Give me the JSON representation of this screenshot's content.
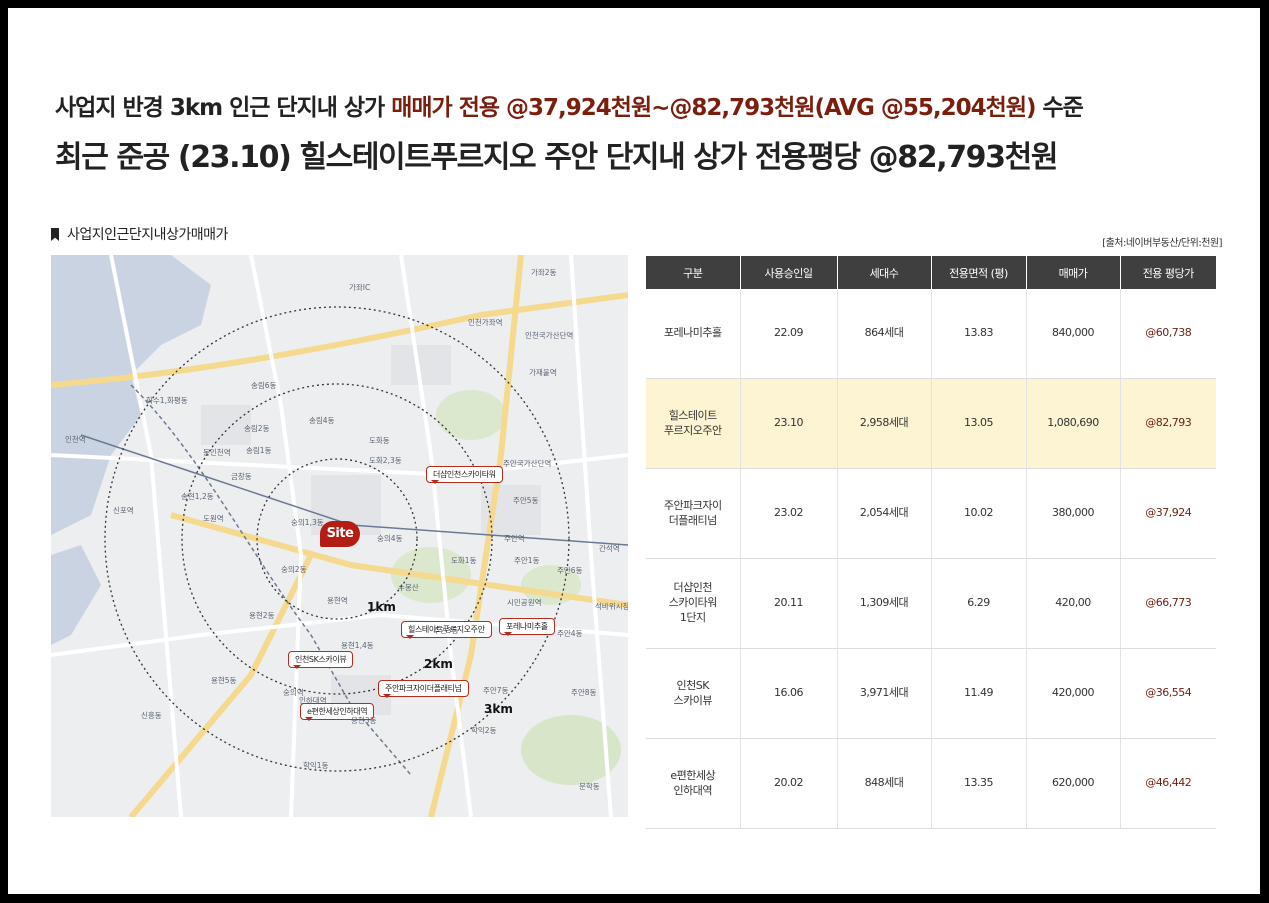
{
  "headline": {
    "line1_prefix": "사업지 반경 3km 인근 단지내 상가 ",
    "line1_highlight": "매매가 전용 @37,924천원~@82,793천원(AVG @55,204천원)",
    "line1_suffix": " 수준",
    "line2": "최근 준공 (23.10) 힐스테이트푸르지오 주안 단지내 상가 전용평당 @82,793천원"
  },
  "section_title": "사업지인근단지내상가매매가",
  "source_note": "[출처:네이버부동산/단위:천원]",
  "map": {
    "site_label": "Site",
    "ring_labels": [
      "1km",
      "2km",
      "3km"
    ],
    "tags": [
      {
        "name": "tag-the-sharp",
        "label": "더샵인천스카이타워"
      },
      {
        "name": "tag-hillstate",
        "label": "힐스테이트푸르지오주안"
      },
      {
        "name": "tag-poreunamiju",
        "label": "포레나미추홀"
      },
      {
        "name": "tag-incheon-sk",
        "label": "인천SK스카이뷰"
      },
      {
        "name": "tag-juan-park",
        "label": "주안파크자이더플래티넘"
      },
      {
        "name": "tag-epyeonhan",
        "label": "e편한세상인하대역"
      }
    ],
    "place_labels": [
      "가좌IC",
      "인천가좌역",
      "가좌2동",
      "가재울역",
      "인천국가산단역",
      "주안국가산단역",
      "도화2,3동",
      "도화동",
      "주안역",
      "주안5동",
      "주안1동",
      "도화1동",
      "주안6동",
      "시민공원역",
      "간석역",
      "석바위시장역",
      "숭의4동",
      "숭의2동",
      "숭의1,3동",
      "도원역",
      "동인천역",
      "인천역",
      "송림6동",
      "송림4동",
      "송림2동",
      "송림1동",
      "금창동",
      "송현1,2동",
      "화수1,화평동",
      "용현1,4동",
      "용현5동",
      "용현3동",
      "용현2동",
      "학익1동",
      "학익2동",
      "주안4동",
      "주안8동",
      "주안7동",
      "신흥동",
      "문학동",
      "숭의역",
      "인하대역",
      "주안3동",
      "신포역",
      "용현역",
      "수봉산"
    ]
  },
  "table": {
    "headers": [
      "구분",
      "사용승인일",
      "세대수",
      "전용면적 (평)",
      "매매가",
      "전용 평당가"
    ],
    "rows": [
      {
        "name": "포레나미추홀",
        "date": "22.09",
        "units": "864세대",
        "area": "13.83",
        "price": "840,000",
        "per_py": "@60,738",
        "highlight": false
      },
      {
        "name": "힐스테이트\n푸르지오주안",
        "date": "23.10",
        "units": "2,958세대",
        "area": "13.05",
        "price": "1,080,690",
        "per_py": "@82,793",
        "highlight": true
      },
      {
        "name": "주안파크자이\n더플래티넘",
        "date": "23.02",
        "units": "2,054세대",
        "area": "10.02",
        "price": "380,000",
        "per_py": "@37,924",
        "highlight": false
      },
      {
        "name": "더샵인천\n스카이타워\n1단지",
        "date": "20.11",
        "units": "1,309세대",
        "area": "6.29",
        "price": "420,00",
        "per_py": "@66,773",
        "highlight": false
      },
      {
        "name": "인천SK\n스카이뷰",
        "date": "16.06",
        "units": "3,971세대",
        "area": "11.49",
        "price": "420,000",
        "per_py": "@36,554",
        "highlight": false
      },
      {
        "name": "e편한세상\n인하대역",
        "date": "20.02",
        "units": "848세대",
        "area": "13.35",
        "price": "620,000",
        "per_py": "@46,442",
        "highlight": false
      }
    ]
  },
  "colors": {
    "accent": "#7a1e0e",
    "site_marker": "#b31d14",
    "highlight_row": "#fcf4d2",
    "table_header": "#3f3f3f"
  }
}
